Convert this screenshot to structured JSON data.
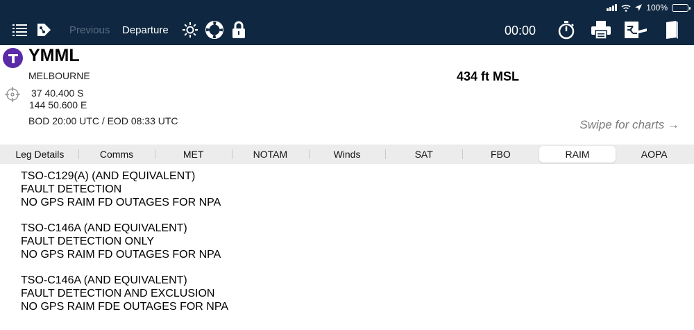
{
  "status_bar": {
    "battery_text": "100%"
  },
  "toolbar": {
    "previous_label": "Previous",
    "departure_label": "Departure",
    "timer": "00:00",
    "icons": [
      "list-icon",
      "route-icon",
      "brightness-icon",
      "lifebuoy-icon",
      "lock-icon",
      "stopwatch-icon",
      "printer-icon",
      "flight-plan-icon",
      "book-icon"
    ]
  },
  "airport": {
    "icao": "YMML",
    "city": "MELBOURNE",
    "lat": "37 40.400 S",
    "lon": "144 50.600 E",
    "elevation": "434 ft MSL",
    "daylight": "BOD 20:00 UTC / EOD 08:33 UTC",
    "swipe_hint": "Swipe for charts →"
  },
  "tabs": [
    {
      "label": "Leg Details"
    },
    {
      "label": "Comms"
    },
    {
      "label": "MET"
    },
    {
      "label": "NOTAM"
    },
    {
      "label": "Winds"
    },
    {
      "label": "SAT"
    },
    {
      "label": "FBO"
    },
    {
      "label": "RAIM",
      "active": true
    },
    {
      "label": "AOPA"
    }
  ],
  "raim": [
    {
      "line1": "TSO-C129(A) (AND EQUIVALENT)",
      "line2": "FAULT DETECTION",
      "line3": "NO GPS RAIM FD OUTAGES FOR NPA"
    },
    {
      "line1": "TSO-C146A (AND EQUIVALENT)",
      "line2": "FAULT DETECTION ONLY",
      "line3": "NO GPS RAIM FD OUTAGES FOR NPA"
    },
    {
      "line1": "TSO-C146A (AND EQUIVALENT)",
      "line2": "FAULT DETECTION AND EXCLUSION",
      "line3": "NO GPS RAIM FDE OUTAGES FOR NPA"
    }
  ],
  "colors": {
    "topbar": "#0f2740",
    "accent_logo": "#5a2aa8",
    "battery": "#4cd964"
  }
}
